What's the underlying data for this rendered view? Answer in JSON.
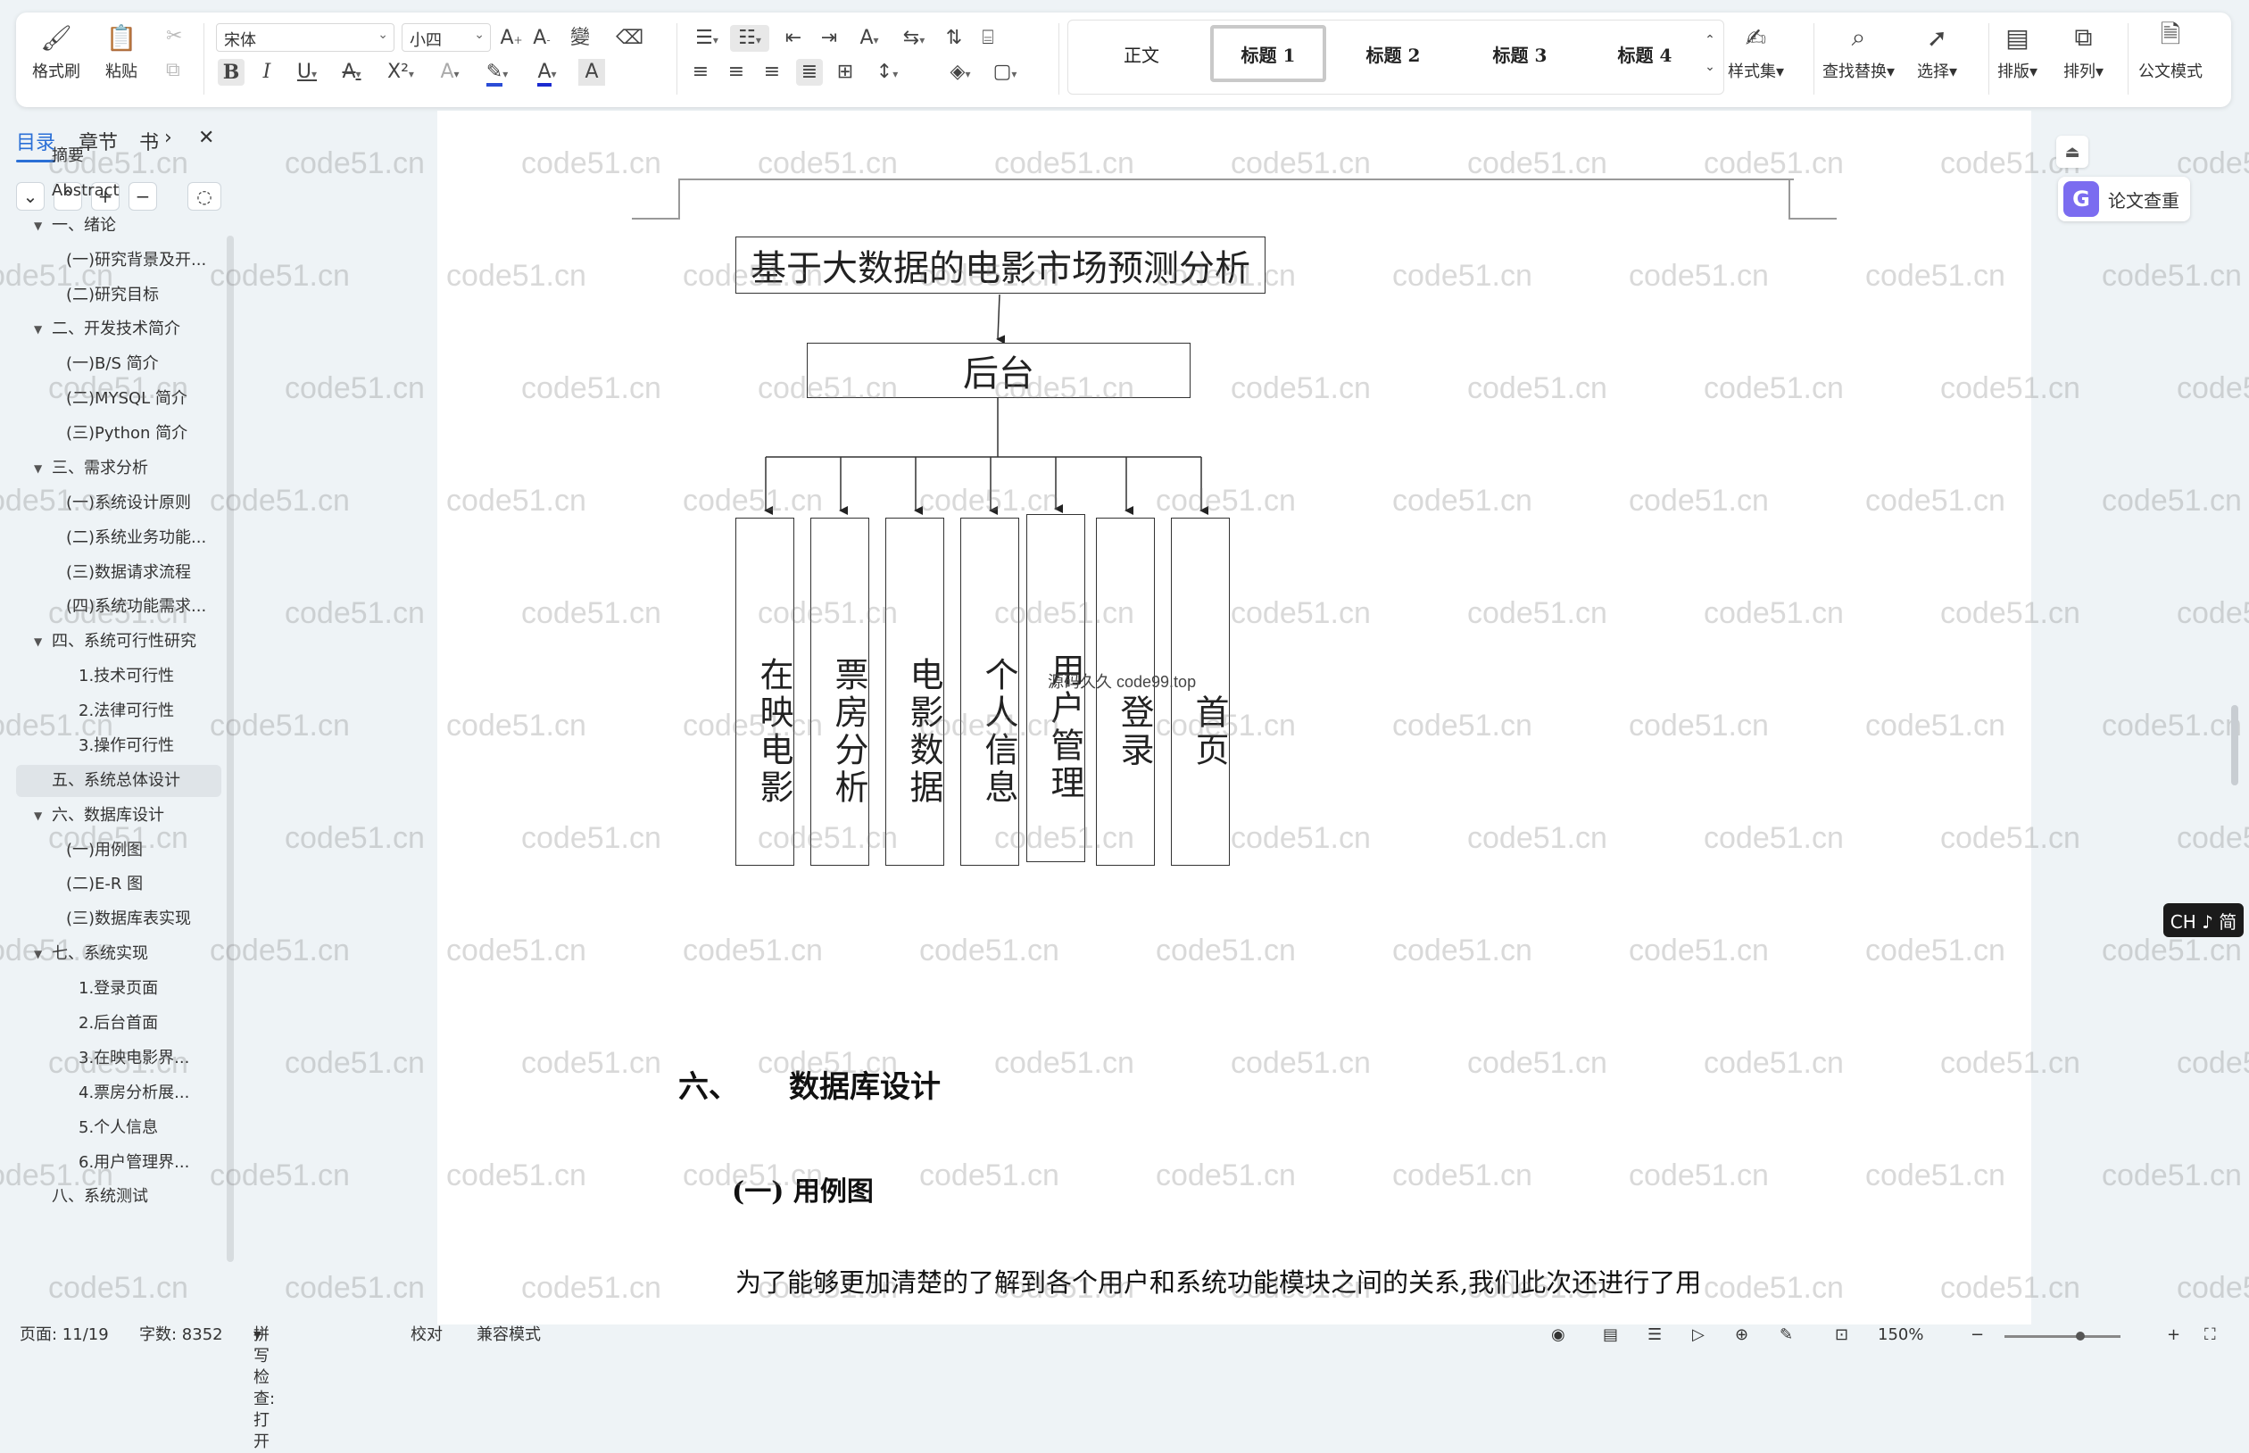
{
  "toolbar": {
    "format_painter": "格式刷",
    "paste": "粘贴",
    "font_name": "宋体",
    "font_size": "小四",
    "styles": [
      "正文",
      "标题 1",
      "标题 2",
      "标题 3",
      "标题 4"
    ],
    "style_set": "样式集",
    "find_replace": "查找替换",
    "select": "选择",
    "layout": "排版",
    "arrange": "排列",
    "doc_mode": "公文模式"
  },
  "sidebar": {
    "tabs": [
      "目录",
      "章节",
      "书"
    ],
    "items": [
      {
        "label": "摘要",
        "level": 1,
        "caret": false
      },
      {
        "label": "Abstract",
        "level": 1,
        "caret": false
      },
      {
        "label": "一、绪论",
        "level": 1,
        "caret": true
      },
      {
        "label": "(一)研究背景及开...",
        "level": 2,
        "caret": false
      },
      {
        "label": "(二)研究目标",
        "level": 2,
        "caret": false
      },
      {
        "label": "二、开发技术简介",
        "level": 1,
        "caret": true
      },
      {
        "label": "(一)B/S 简介",
        "level": 2,
        "caret": false
      },
      {
        "label": "(二)MYSQL 简介",
        "level": 2,
        "caret": false
      },
      {
        "label": "(三)Python 简介",
        "level": 2,
        "caret": false
      },
      {
        "label": "三、需求分析",
        "level": 1,
        "caret": true
      },
      {
        "label": "(一)系统设计原则",
        "level": 2,
        "caret": false
      },
      {
        "label": "(二)系统业务功能...",
        "level": 2,
        "caret": false
      },
      {
        "label": "(三)数据请求流程",
        "level": 2,
        "caret": false
      },
      {
        "label": "(四)系统功能需求...",
        "level": 2,
        "caret": false
      },
      {
        "label": "四、系统可行性研究",
        "level": 1,
        "caret": true
      },
      {
        "label": "1.技术可行性",
        "level": 3,
        "caret": false
      },
      {
        "label": "2.法律可行性",
        "level": 3,
        "caret": false
      },
      {
        "label": "3.操作可行性",
        "level": 3,
        "caret": false
      },
      {
        "label": "五、系统总体设计",
        "level": 1,
        "caret": false,
        "active": true
      },
      {
        "label": "六、数据库设计",
        "level": 1,
        "caret": true
      },
      {
        "label": "(一)用例图",
        "level": 2,
        "caret": false
      },
      {
        "label": "(二)E-R 图",
        "level": 2,
        "caret": false
      },
      {
        "label": "(三)数据库表实现",
        "level": 2,
        "caret": false
      },
      {
        "label": "七、系统实现",
        "level": 1,
        "caret": true
      },
      {
        "label": "1.登录页面",
        "level": 3,
        "caret": false
      },
      {
        "label": "2.后台首面",
        "level": 3,
        "caret": false
      },
      {
        "label": "3.在映电影界...",
        "level": 3,
        "caret": false
      },
      {
        "label": "4.票房分析展...",
        "level": 3,
        "caret": false
      },
      {
        "label": "5.个人信息",
        "level": 3,
        "caret": false
      },
      {
        "label": "6.用户管理界...",
        "level": 3,
        "caret": false
      },
      {
        "label": "八、系统测试",
        "level": 1,
        "caret": false
      }
    ]
  },
  "document": {
    "diagram": {
      "root": "基于大数据的电影市场预测分析",
      "middle": "后台",
      "leaves": [
        "在映电影",
        "票房分析",
        "电影数据",
        "个人信息",
        "用户管理",
        "登录",
        "首页"
      ],
      "overlay": "源码久久 code99.top"
    },
    "heading_num": "六、",
    "heading_text": "数据库设计",
    "subheading": "(一) 用例图",
    "paragraph": "为了能够更加清楚的了解到各个用户和系统功能模块之间的关系,我们此次还进行了用"
  },
  "watermark": "code51.cn",
  "float": {
    "paper_check": "论文查重"
  },
  "ime": "CH ♪ 简",
  "status": {
    "page": "页面: 11/19",
    "words": "字数: 8352",
    "spell": "拼写检查: 打开",
    "proof": "校对",
    "compat": "兼容模式",
    "zoom": "150%"
  }
}
